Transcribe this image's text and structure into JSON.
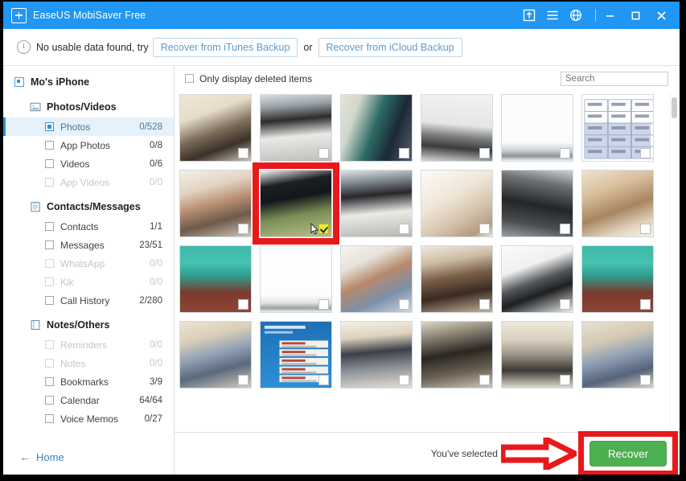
{
  "window": {
    "title": "EaseUS MobiSaver Free",
    "logo_icon": "app-logo-icon",
    "titlebar_color": "#2196f3",
    "icons": [
      {
        "name": "upgrade-icon",
        "glyph": "upgrade"
      },
      {
        "name": "menu-list-icon",
        "glyph": "list"
      },
      {
        "name": "globe-icon",
        "glyph": "globe"
      }
    ],
    "controls": [
      {
        "name": "minimize-button",
        "glyph": "minimize"
      },
      {
        "name": "maximize-button",
        "glyph": "maximize"
      },
      {
        "name": "close-button",
        "glyph": "close"
      }
    ]
  },
  "notice": {
    "icon": "info-icon",
    "text_before": "No usable data found, try",
    "itunes_button": "Recover from iTunes Backup",
    "or_text": "or",
    "icloud_button": "Recover from iCloud Backup"
  },
  "sidebar": {
    "device": {
      "label": "Mo's iPhone",
      "icon": "device-checkbox-icon"
    },
    "groups": [
      {
        "label": "Photos/Videos",
        "icon": "photos-icon",
        "items": [
          {
            "label": "Photos",
            "count": "0/528",
            "selected": true,
            "disabled": false
          },
          {
            "label": "App Photos",
            "count": "0/8",
            "selected": false,
            "disabled": false
          },
          {
            "label": "Videos",
            "count": "0/6",
            "selected": false,
            "disabled": false
          },
          {
            "label": "App Videos",
            "count": "0/0",
            "selected": false,
            "disabled": true
          }
        ]
      },
      {
        "label": "Contacts/Messages",
        "icon": "clipboard-icon",
        "items": [
          {
            "label": "Contacts",
            "count": "1/1",
            "selected": false,
            "disabled": false
          },
          {
            "label": "Messages",
            "count": "23/51",
            "selected": false,
            "disabled": false
          },
          {
            "label": "WhatsApp",
            "count": "0/0",
            "selected": false,
            "disabled": true
          },
          {
            "label": "Kik",
            "count": "0/0",
            "selected": false,
            "disabled": true
          },
          {
            "label": "Call History",
            "count": "2/280",
            "selected": false,
            "disabled": false
          }
        ]
      },
      {
        "label": "Notes/Others",
        "icon": "notes-icon",
        "items": [
          {
            "label": "Reminders",
            "count": "0/0",
            "selected": false,
            "disabled": true
          },
          {
            "label": "Notes",
            "count": "0/0",
            "selected": false,
            "disabled": true
          },
          {
            "label": "Bookmarks",
            "count": "3/9",
            "selected": false,
            "disabled": false
          },
          {
            "label": "Calendar",
            "count": "64/64",
            "selected": false,
            "disabled": false
          },
          {
            "label": "Voice Memos",
            "count": "0/27",
            "selected": false,
            "disabled": false
          }
        ]
      }
    ],
    "home": {
      "label": "Home",
      "icon": "back-arrow-icon"
    }
  },
  "toolbar": {
    "only_deleted_label": "Only display deleted items",
    "only_deleted_checked": false,
    "search_placeholder": "Search",
    "search_value": ""
  },
  "gallery": {
    "columns": 6,
    "selected_index": 7,
    "thumbnails": [
      {
        "id": 0,
        "desc": "students-sitting-classroom",
        "checked": false,
        "kind": "photo",
        "p": "a"
      },
      {
        "id": 1,
        "desc": "boy-white-shirt-glasses",
        "checked": false,
        "kind": "photo",
        "p": "b"
      },
      {
        "id": 2,
        "desc": "person-by-green-door",
        "checked": false,
        "kind": "photo",
        "p": "c"
      },
      {
        "id": 3,
        "desc": "keyboard-on-white-desk",
        "checked": false,
        "kind": "photo",
        "p": "d"
      },
      {
        "id": 4,
        "desc": "mostly-white-blank-photo",
        "checked": false,
        "kind": "photo",
        "p": "e"
      },
      {
        "id": 5,
        "desc": "spreadsheet-table-screenshot",
        "checked": false,
        "kind": "table",
        "p": "f"
      },
      {
        "id": 6,
        "desc": "girl-and-boys-selfie",
        "checked": false,
        "kind": "photo",
        "p": "g"
      },
      {
        "id": 7,
        "desc": "tv-monitor-green-wall",
        "checked": true,
        "kind": "photo",
        "p": "h"
      },
      {
        "id": 8,
        "desc": "boy-white-shirt-classroom",
        "checked": false,
        "kind": "photo",
        "p": "i"
      },
      {
        "id": 9,
        "desc": "blurred-hand-light",
        "checked": false,
        "kind": "photo",
        "p": "j"
      },
      {
        "id": 10,
        "desc": "dark-blurred-frame",
        "checked": false,
        "kind": "photo",
        "p": "k"
      },
      {
        "id": 11,
        "desc": "warm-blurred-interior",
        "checked": false,
        "kind": "photo",
        "p": "l"
      },
      {
        "id": 12,
        "desc": "green-metal-shelving",
        "checked": false,
        "kind": "photo",
        "p": "m"
      },
      {
        "id": 13,
        "desc": "white-floor-blank",
        "checked": false,
        "kind": "photo",
        "p": "n"
      },
      {
        "id": 14,
        "desc": "two-women-with-glasses",
        "checked": false,
        "kind": "photo",
        "p": "o"
      },
      {
        "id": 15,
        "desc": "person-on-staircase",
        "checked": false,
        "kind": "photo",
        "p": "q"
      },
      {
        "id": 16,
        "desc": "tablet-on-white-surface",
        "checked": false,
        "kind": "photo",
        "p": "r"
      },
      {
        "id": 17,
        "desc": "green-metal-shelving-2",
        "checked": false,
        "kind": "photo",
        "p": "m"
      },
      {
        "id": 18,
        "desc": "boy-lying-on-floor",
        "checked": false,
        "kind": "photo",
        "p": "s"
      },
      {
        "id": 19,
        "desc": "phone-app-list-screenshot",
        "checked": false,
        "kind": "app",
        "p": "t"
      },
      {
        "id": 20,
        "desc": "student-leaning-on-desk",
        "checked": false,
        "kind": "photo",
        "p": "u"
      },
      {
        "id": 21,
        "desc": "students-on-classroom-floor",
        "checked": false,
        "kind": "photo",
        "p": "v"
      },
      {
        "id": 22,
        "desc": "people-standing-classroom",
        "checked": false,
        "kind": "photo",
        "p": "w"
      },
      {
        "id": 23,
        "desc": "boy-sitting-on-floor",
        "checked": false,
        "kind": "photo",
        "p": "x"
      }
    ]
  },
  "status": {
    "selected_text": "You've selected 1 item(s)(1.2 MB)",
    "recover_label": "Recover",
    "recover_color": "#4caf50",
    "annotation_color": "#e8191b"
  }
}
